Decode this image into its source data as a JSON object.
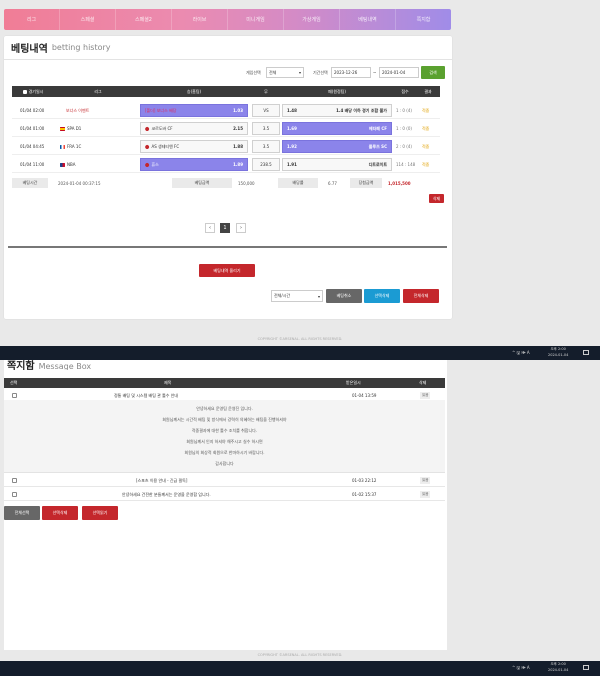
{
  "nav": {
    "items": [
      "리그",
      "스페셜",
      "스페셜2",
      "라이브",
      "미니게임",
      "가상게임",
      "베팅내역",
      "쪽지함"
    ]
  },
  "betting": {
    "title": "베팅내역",
    "subtitle": "betting history",
    "filter": {
      "game_select_label": "게임선택",
      "game_select_value": "전체",
      "period_label": "기간선택",
      "date_from": "2023-12-26",
      "tilde": "~",
      "date_to": "2024-01-04",
      "search_button": "검색"
    },
    "columns": [
      "경기일시",
      "리그",
      "승(홈팀)",
      "무",
      "패(원정팀)",
      "점수",
      "결과"
    ],
    "rows": [
      {
        "time": "01/04 02:00",
        "league": "보너스 이벤트",
        "home": "[폴더] 보너스 배당",
        "home_odds": "1.03",
        "draw": "VS",
        "away_odds": "1.48",
        "away": "1.4 배당 이하 경기 조합 불가",
        "score": "1 : 0 (4)",
        "result": "적중",
        "selected": "home",
        "flag": ""
      },
      {
        "time": "01/04 01:00",
        "league": "SPA D1",
        "home": "코르도바 CF",
        "home_odds": "2.15",
        "draw": "3.5",
        "away_odds": "1.69",
        "away": "헤타페 CF",
        "score": "1 : 0 (0)",
        "result": "적중",
        "selected": "away",
        "flag": "spain"
      },
      {
        "time": "01/04 04:45",
        "league": "FRA 1C",
        "home": "AS 생테티엔 FC",
        "home_odds": "1.88",
        "draw": "3.5",
        "away_odds": "1.92",
        "away": "몰루즈 SC",
        "score": "2 : 0 (4)",
        "result": "적중",
        "selected": "away",
        "flag": "france"
      },
      {
        "time": "01/04 11:00",
        "league": "NBA",
        "home": "휴스",
        "home_odds": "1.89",
        "draw": "238.5",
        "away_odds": "1.91",
        "away": "디트로이트",
        "score": "114 : 148",
        "result": "적중",
        "selected": "home",
        "flag": "usa"
      }
    ],
    "summary": {
      "bet_time_label": "베팅시간",
      "bet_time_value": "2024-01-04 00:37:15",
      "bet_amount_label": "베팅금액",
      "bet_amount_value": "150,000",
      "odds_label": "배당률",
      "odds_value": "6.77",
      "win_amount_label": "당첨금액",
      "win_amount_value": "1,015,500"
    },
    "delete_button": "삭제",
    "pager": {
      "prev": "‹",
      "current": "1",
      "next": "›"
    },
    "history_button": "베팅내역 올리기",
    "bottom": {
      "sort_select": "전체/시간",
      "cancel_button": "베팅취소",
      "select_delete_button": "선택삭제",
      "all_delete_button": "전체삭제"
    }
  },
  "copyright": "COPYRIGHT ©ARSENAL. ALL RIGHTS RESERVED.",
  "taskbar": {
    "tray": "^ 🖫 🕪 A",
    "time": "오후 2:00",
    "date": "2024-01-04"
  },
  "message": {
    "title": "쪽지함",
    "subtitle": "Message Box",
    "columns": [
      "선택",
      "제목",
      "받은일시",
      "삭제"
    ],
    "rows": [
      {
        "subject": "정통 배팅 및 시스템 배팅 관 툴수 안내",
        "date": "01-04 13:59",
        "action": "읽음"
      },
      {
        "subject": "[스포츠 이용 안내 - 긴급 필독]",
        "date": "01-03 22:12",
        "action": "읽음"
      },
      {
        "subject": "안녕하세요 건전한 분들께서는 운영을 운영합 입니다.",
        "date": "01-02 15:37",
        "action": "읽음"
      }
    ],
    "expanded_lines": [
      "안녕하세요 운영팀 운영진 입니다.",
      "회원님께서는 시간적 배팅 및 방식에서 강력히 의혜하는 배팅을 진행하셔야",
      "적중결과에 대한 툴수 조치를 취합니다.",
      "회원님께서 인지 하셔야 해주시고 실수 하시면",
      "회원님의 회상적 회원으로 한마하시기 바랍니다.",
      "감사합니다"
    ],
    "buttons": {
      "select_all": "전체선택",
      "select_delete": "선택삭제",
      "select_read": "선택읽기"
    }
  }
}
